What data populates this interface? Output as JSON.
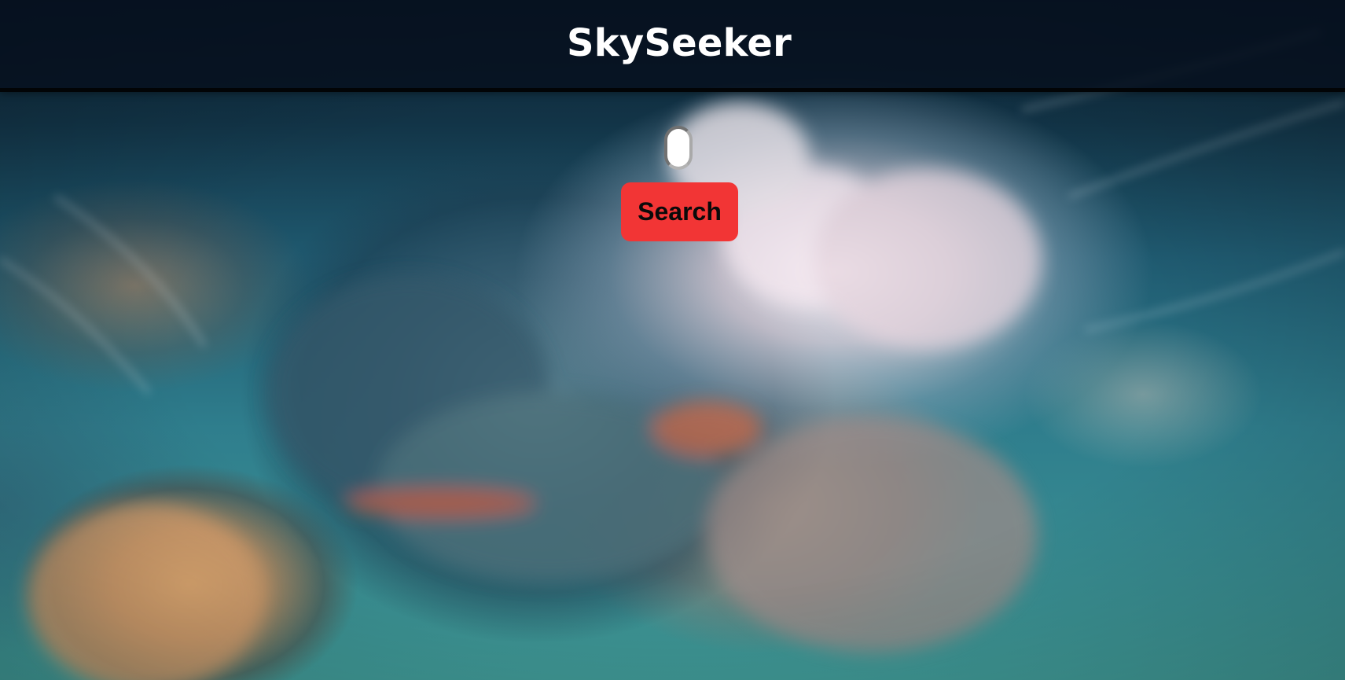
{
  "app": {
    "title": "SkySeeker"
  },
  "search": {
    "value": "",
    "placeholder": "",
    "button_label": "Search"
  },
  "background": {
    "icon": "storm-cloud-photo"
  },
  "colors": {
    "header": "#06101e",
    "search_button": "#f23535",
    "title_text": "#ffffff"
  }
}
